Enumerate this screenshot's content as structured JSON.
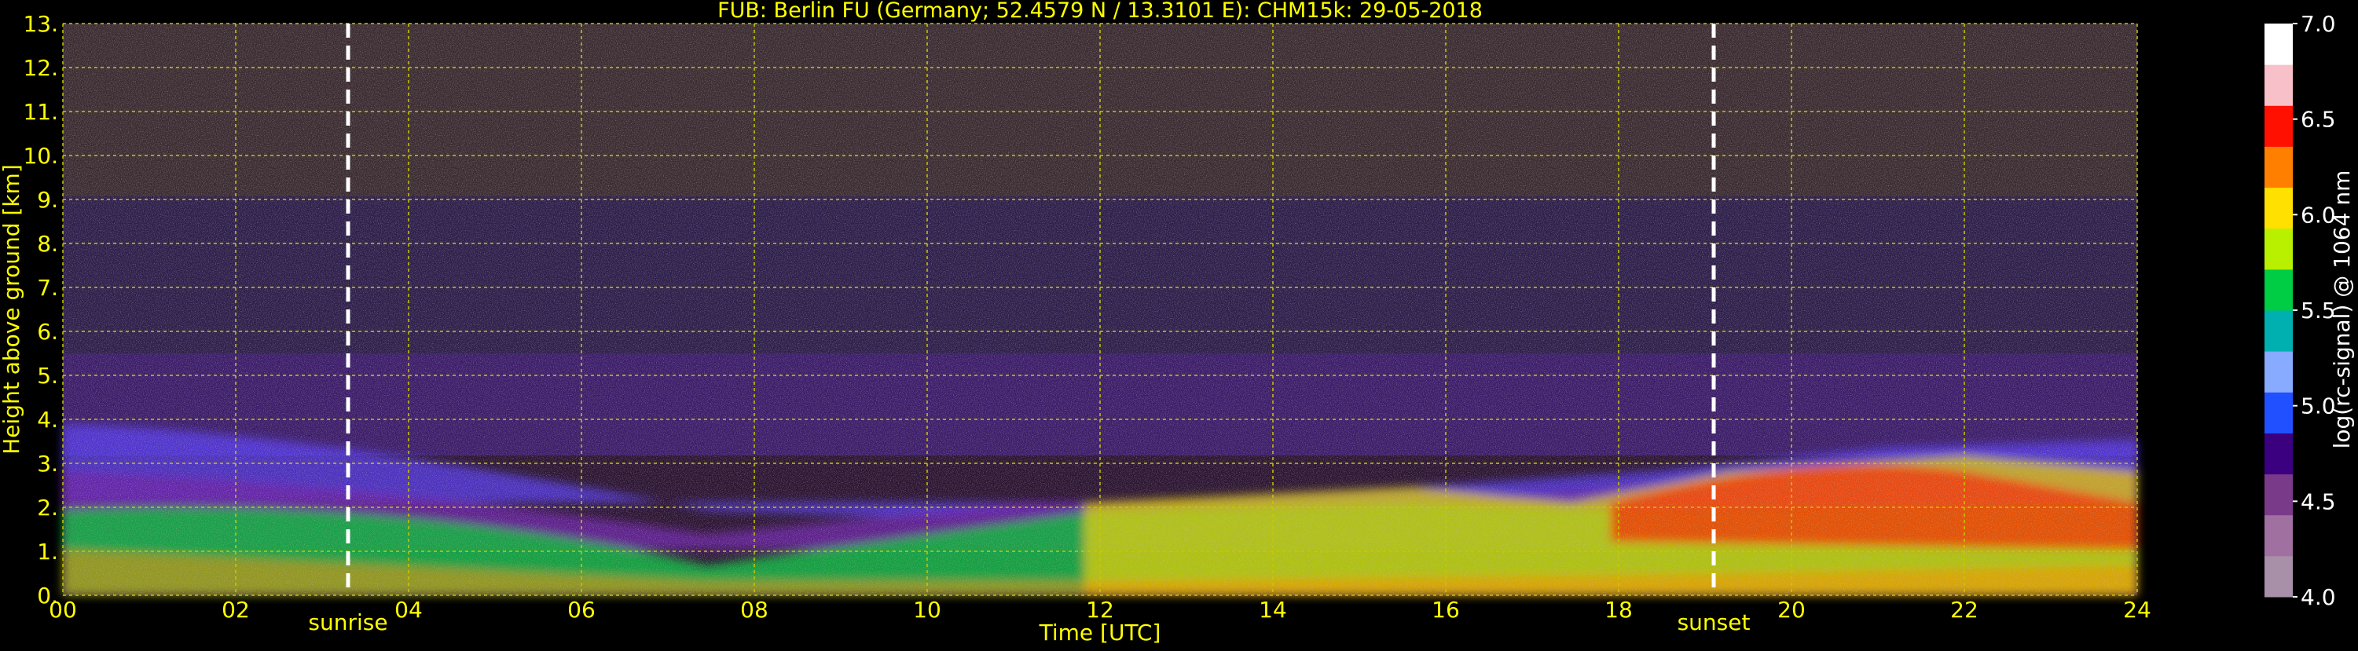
{
  "chart_data": {
    "type": "heatmap",
    "title": "FUB: Berlin FU (Germany; 52.4579 N / 13.3101 E):    CHM15k: 29-05-2018",
    "xlabel": "Time [UTC]",
    "ylabel": "Height above ground [km]",
    "colorbar_label": "log(rc-signal) @ 1064 nm",
    "x_ticks": [
      "00",
      "02",
      "04",
      "06",
      "08",
      "10",
      "12",
      "14",
      "16",
      "18",
      "20",
      "22",
      "24"
    ],
    "y_ticks": [
      "0.",
      "1.",
      "2.",
      "3.",
      "4.",
      "5.",
      "6.",
      "7.",
      "8.",
      "9.",
      "10.",
      "11.",
      "12.",
      "13."
    ],
    "colorbar_ticks": [
      "4.0",
      "4.5",
      "5.0",
      "5.5",
      "6.0",
      "6.5",
      "7.0"
    ],
    "xlim": [
      0,
      24
    ],
    "ylim": [
      0,
      13
    ],
    "clim": [
      4.0,
      7.0
    ],
    "grid": true,
    "markers": [
      {
        "label": "sunrise",
        "x": 3.3
      },
      {
        "label": "sunset",
        "x": 19.1
      }
    ],
    "colors": {
      "text": "#ffff00",
      "grid": "#c8c800",
      "background": "#000000",
      "marker_line": "#ffffff",
      "colorbar_scale": [
        "#a890a8",
        "#a070a0",
        "#7a3a8a",
        "#3a0080",
        "#2050ff",
        "#88aaff",
        "#00b0b0",
        "#00cc44",
        "#b8f000",
        "#ffe000",
        "#ff8000",
        "#ff1000",
        "#f8c0c8",
        "#ffffff"
      ]
    }
  }
}
